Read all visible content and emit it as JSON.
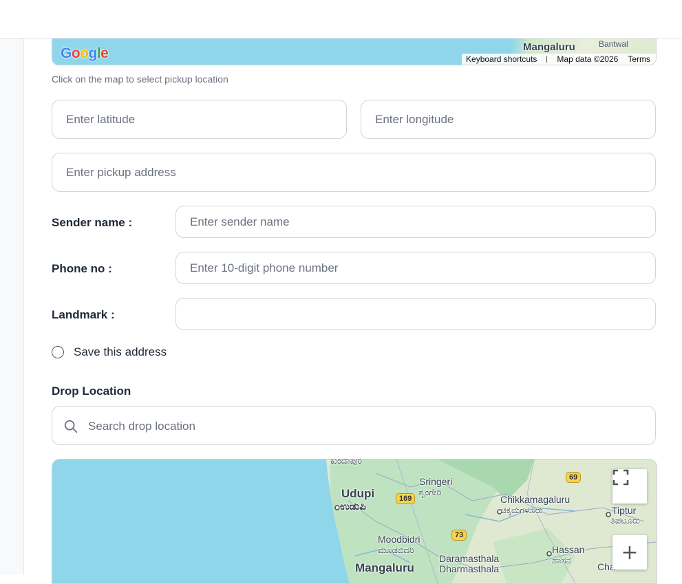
{
  "pickup_map": {
    "logo": "Google",
    "labels": {
      "city": "Mangaluru",
      "town": "Bantwal"
    },
    "attribution": {
      "shortcuts": "Keyboard shortcuts",
      "map_data": "Map data ©2026",
      "terms": "Terms"
    }
  },
  "pickup": {
    "hint": "Click on the map to select pickup location",
    "latitude_placeholder": "Enter latitude",
    "longitude_placeholder": "Enter longitude",
    "address_placeholder": "Enter pickup address",
    "sender_label": "Sender name :",
    "sender_placeholder": "Enter sender name",
    "phone_label": "Phone no :",
    "phone_placeholder": "Enter 10-digit phone number",
    "landmark_label": "Landmark :",
    "landmark_value": "",
    "save_label": "Save this address",
    "save_checked": false
  },
  "drop": {
    "title": "Drop Location",
    "search_placeholder": "Search drop location"
  },
  "drop_map": {
    "places": {
      "udupi": "Udupi",
      "udupi_kn": "ಉಡುಪಿ",
      "sringeri": "Sringeri",
      "sringeri_kn": "ಶೃಂಗೇರಿ",
      "chikkamagaluru": "Chikkamagaluru",
      "chikkamagaluru_kn": "ಚಿಕ್ಕಮಗಳೂರು",
      "tiptur": "Tiptur",
      "tiptur_kn": "ತಿಪಟೂರು",
      "moodbidri": "Moodbidri",
      "moodbidri_kn": "ಮೂಡಬಿದರಿ",
      "dharmasthala": "Daramasthala",
      "dharmasthala_en": "Dharmasthala",
      "hassan": "Hassan",
      "hassan_kn": "ಹಾಸನ",
      "mangaluru": "Mangaluru",
      "kundapura_kn": "ಕುಂದಾಪುರ",
      "cha": "Cha"
    },
    "highways": [
      "169",
      "69",
      "73"
    ],
    "controls": {
      "zoom_in": "+"
    }
  },
  "colors": {
    "water": "#8fd6ea",
    "land": "#e5efd9",
    "forest": "#bfe3c0",
    "border": "#d1d5db"
  }
}
